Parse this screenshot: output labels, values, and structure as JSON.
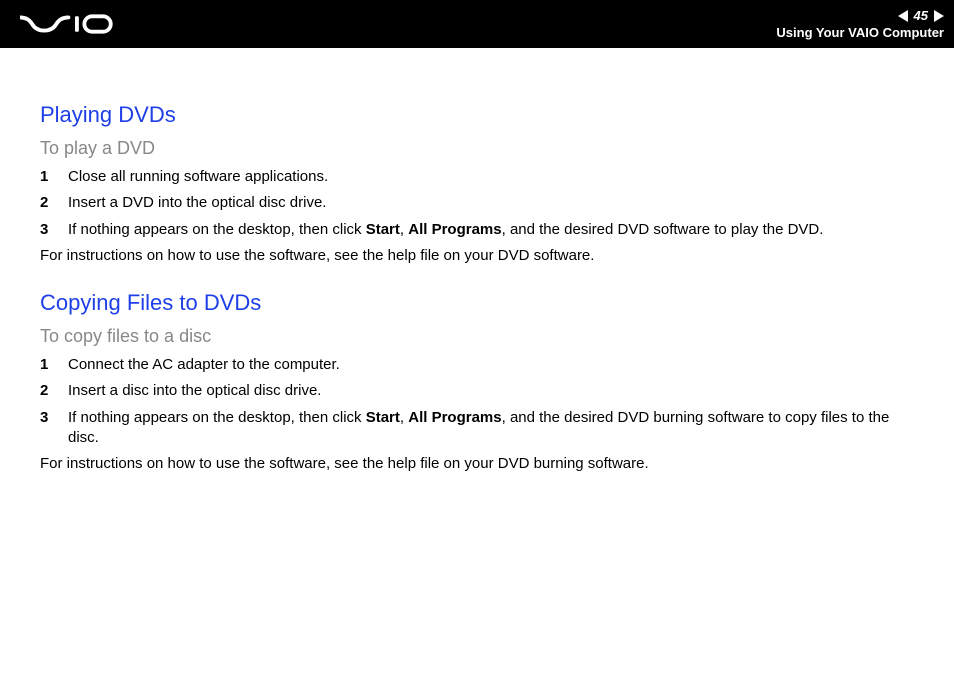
{
  "header": {
    "page_number": "45",
    "section_label": "Using Your VAIO Computer"
  },
  "section1": {
    "title": "Playing DVDs",
    "subtitle": "To play a DVD",
    "steps": [
      {
        "num": "1",
        "text": "Close all running software applications."
      },
      {
        "num": "2",
        "text": "Insert a DVD into the optical disc drive."
      },
      {
        "num": "3",
        "pre": "If nothing appears on the desktop, then click ",
        "b1": "Start",
        "sep1": ", ",
        "b2": "All Programs",
        "post": ", and the desired DVD software to play the DVD."
      }
    ],
    "note": "For instructions on how to use the software, see the help file on your DVD software."
  },
  "section2": {
    "title": "Copying Files to DVDs",
    "subtitle": "To copy files to a disc",
    "steps": [
      {
        "num": "1",
        "text": "Connect the AC adapter to the computer."
      },
      {
        "num": "2",
        "text": "Insert a disc into the optical disc drive."
      },
      {
        "num": "3",
        "pre": "If nothing appears on the desktop, then click ",
        "b1": "Start",
        "sep1": ", ",
        "b2": "All Programs",
        "post": ", and the desired DVD burning software to copy files to the disc."
      }
    ],
    "note": "For instructions on how to use the software, see the help file on your DVD burning software."
  }
}
